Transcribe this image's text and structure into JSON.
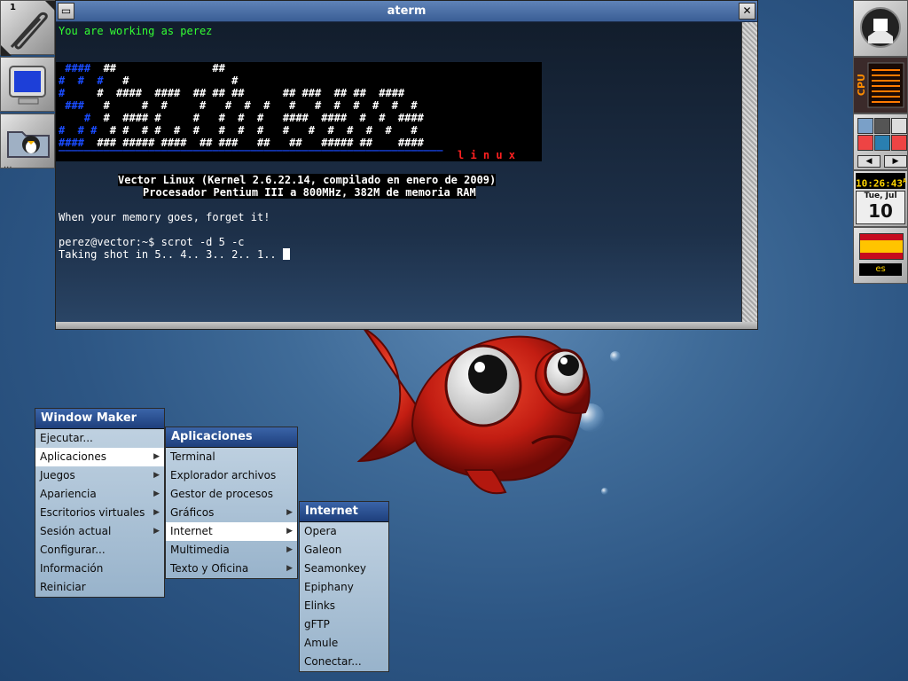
{
  "workspace_number": "1",
  "terminal": {
    "title": "aterm",
    "status_line": "You are working as perez",
    "logo_tag": "l i n u x",
    "line1": "Vector Linux (Kernel 2.6.22.14, compilado en enero de 2009)",
    "line2": "Procesador Pentium III a 800MHz, 382M de memoria RAM",
    "fortune": "When your memory goes, forget it!",
    "prompt": "perez@vector:~$ scrot -d 5 -c",
    "output": "Taking shot in 5.. 4.. 3.. 2.. 1.. "
  },
  "menus": {
    "main": {
      "title": "Window Maker",
      "items": [
        {
          "label": "Ejecutar...",
          "sub": false
        },
        {
          "label": "Aplicaciones",
          "sub": true
        },
        {
          "label": "Juegos",
          "sub": true
        },
        {
          "label": "Apariencia",
          "sub": true
        },
        {
          "label": "Escritorios virtuales",
          "sub": true
        },
        {
          "label": "Sesión actual",
          "sub": true
        },
        {
          "label": "Configurar...",
          "sub": false
        },
        {
          "label": "Información",
          "sub": false
        },
        {
          "label": "Reiniciar",
          "sub": false
        }
      ],
      "selected": "Aplicaciones"
    },
    "aplicaciones": {
      "title": "Aplicaciones",
      "items": [
        {
          "label": "Terminal",
          "sub": false
        },
        {
          "label": "Explorador archivos",
          "sub": false
        },
        {
          "label": "Gestor de procesos",
          "sub": false
        },
        {
          "label": "Gráficos",
          "sub": true
        },
        {
          "label": "Internet",
          "sub": true
        },
        {
          "label": "Multimedia",
          "sub": true
        },
        {
          "label": "Texto y Oficina",
          "sub": true
        }
      ],
      "selected": "Internet"
    },
    "internet": {
      "title": "Internet",
      "items": [
        {
          "label": "Opera"
        },
        {
          "label": "Galeon"
        },
        {
          "label": "Seamonkey"
        },
        {
          "label": "Epiphany"
        },
        {
          "label": "Elinks"
        },
        {
          "label": "gFTP"
        },
        {
          "label": "Amule"
        },
        {
          "label": "Conectar..."
        }
      ]
    }
  },
  "dock": {
    "cpu_label": "CPU",
    "clock_time": "10:26:43",
    "clock_ampm": "A",
    "date_day": "Tue, Jul",
    "date_num": "10",
    "lang": "es"
  },
  "colors": {
    "green_text": "#33ff33",
    "menu_title": "#2a4f92",
    "desktop": "#3f6b98"
  }
}
